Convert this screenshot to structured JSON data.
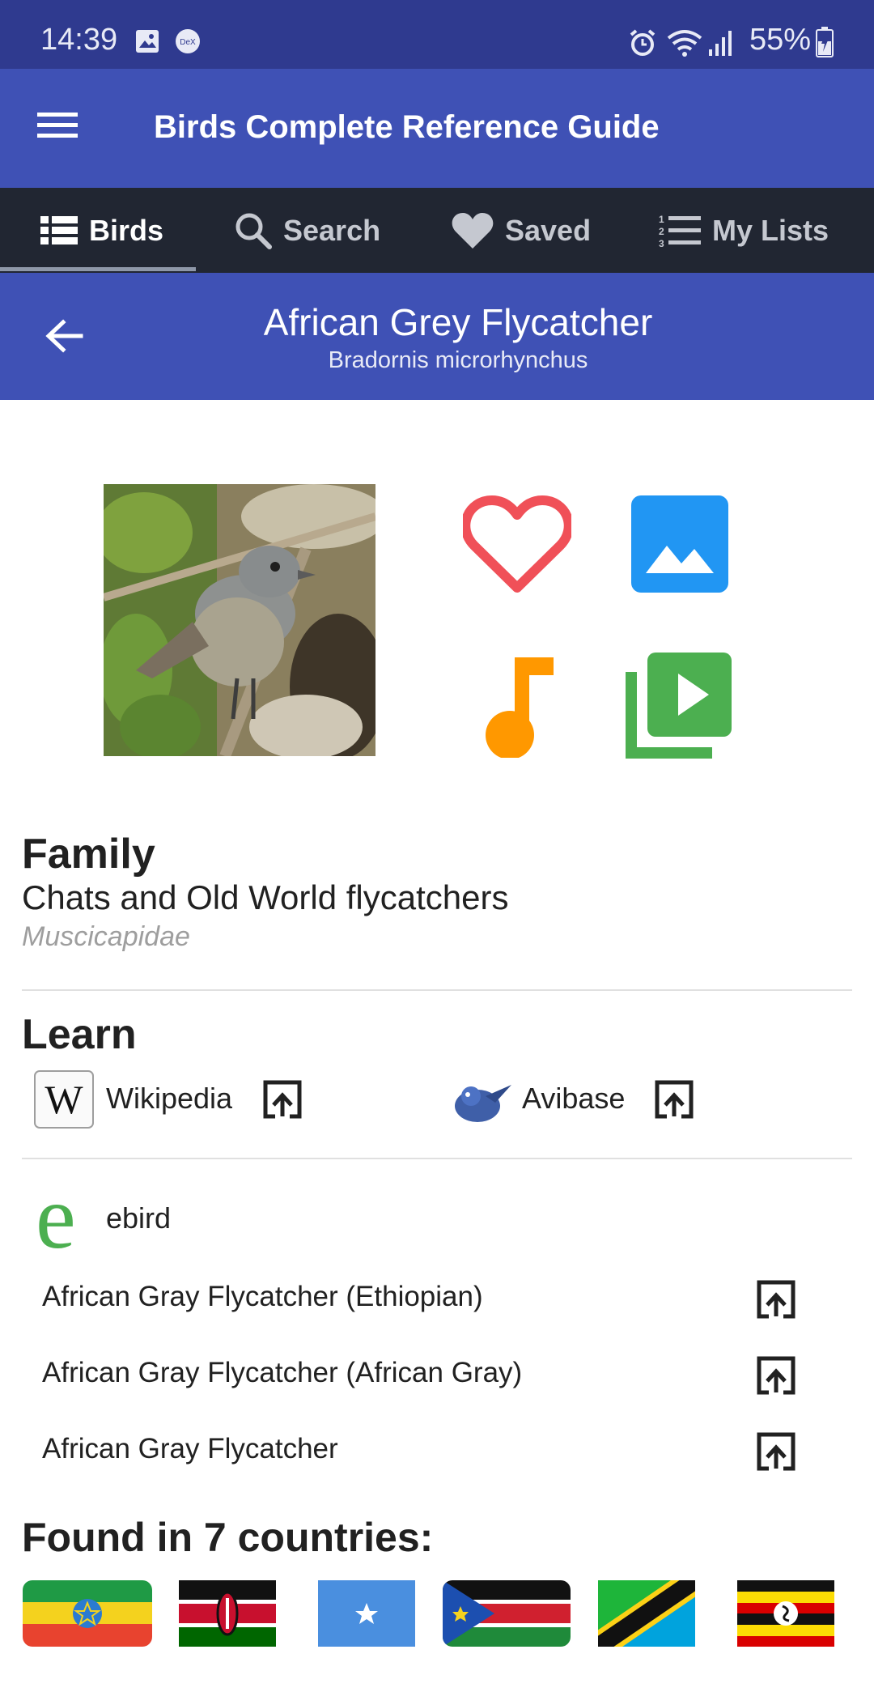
{
  "status_bar": {
    "time": "14:39",
    "battery": "55%"
  },
  "app_bar": {
    "title": "Birds Complete Reference Guide",
    "menu_icon": "hamburger-menu-icon"
  },
  "tabs": [
    {
      "label": "Birds",
      "icon": "list-icon",
      "active": true
    },
    {
      "label": "Search",
      "icon": "search-icon",
      "active": false
    },
    {
      "label": "Saved",
      "icon": "heart-icon",
      "active": false
    },
    {
      "label": "My Lists",
      "icon": "numbered-list-icon",
      "active": false
    }
  ],
  "header": {
    "common_name": "African Grey Flycatcher",
    "scientific_name": "Bradornis microrhynchus"
  },
  "actions": {
    "favorite_color": "#f05058",
    "gallery_color": "#2196f3",
    "sound_color": "#ff9800",
    "video_color": "#4caf50"
  },
  "family": {
    "heading": "Family",
    "common": "Chats and Old World flycatchers",
    "scientific": "Muscicapidae"
  },
  "learn": {
    "heading": "Learn",
    "wikipedia": "Wikipedia",
    "avibase": "Avibase"
  },
  "ebird": {
    "label": "ebird",
    "logo_letter": "e",
    "items": [
      "African Gray Flycatcher (Ethiopian)",
      "African Gray Flycatcher (African Gray)",
      "African Gray Flycatcher"
    ]
  },
  "countries": {
    "heading": "Found in 7 countries:",
    "flags": [
      "ethiopia-flag",
      "kenya-flag",
      "somalia-flag",
      "south-sudan-flag",
      "tanzania-flag",
      "uganda-flag"
    ]
  }
}
